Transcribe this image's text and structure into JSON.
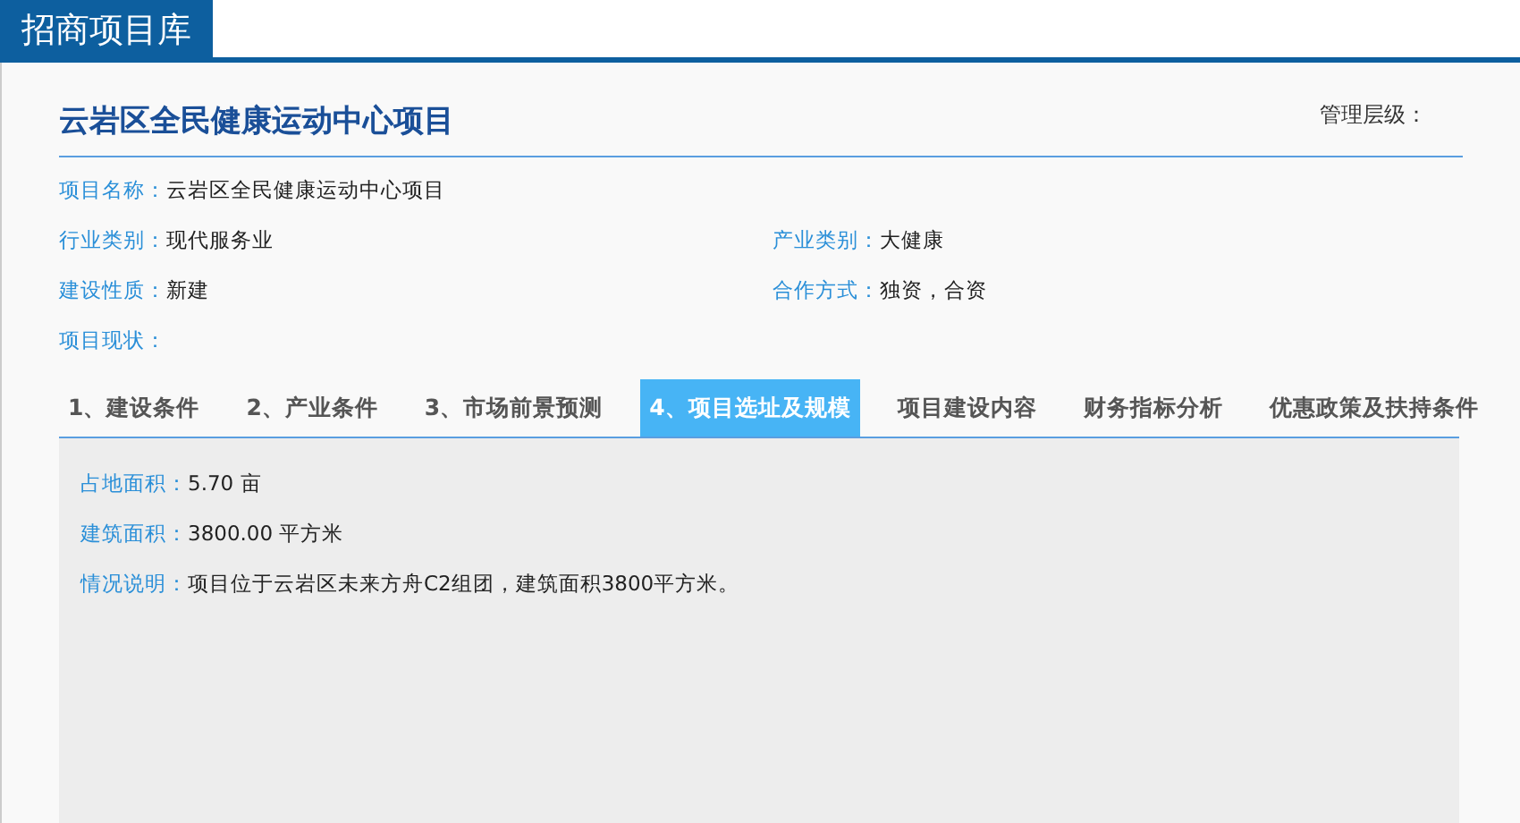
{
  "header": {
    "title": "招商项目库"
  },
  "project": {
    "title": "云岩区全民健康运动中心项目",
    "management_level_label": "管理层级："
  },
  "field_rows": [
    [
      {
        "label": "项目名称：",
        "value": "云岩区全民健康运动中心项目"
      }
    ],
    [
      {
        "label": "行业类别：",
        "value": "现代服务业"
      },
      {
        "label": "产业类别：",
        "value": "大健康"
      }
    ],
    [
      {
        "label": "建设性质：",
        "value": "新建"
      },
      {
        "label": "合作方式：",
        "value": "独资，合资"
      }
    ],
    [
      {
        "label": "项目现状："
      }
    ]
  ],
  "tabs": [
    {
      "label": "1、建设条件",
      "selected": false
    },
    {
      "label": "2、产业条件",
      "selected": false
    },
    {
      "label": "3、市场前景预测",
      "selected": false
    },
    {
      "label": "4、项目选址及规模",
      "selected": true
    },
    {
      "label": "项目建设内容",
      "selected": false
    },
    {
      "label": "财务指标分析",
      "selected": false
    },
    {
      "label": "优惠政策及扶持条件",
      "selected": false
    }
  ],
  "details": [
    {
      "label": "占地面积：",
      "value": "5.70 亩"
    },
    {
      "label": "建筑面积：",
      "value": "3800.00 平方米"
    },
    {
      "label": "情况说明：",
      "value": "项目位于云岩区未来方舟C2组团，建筑面积3800平方米。"
    }
  ]
}
